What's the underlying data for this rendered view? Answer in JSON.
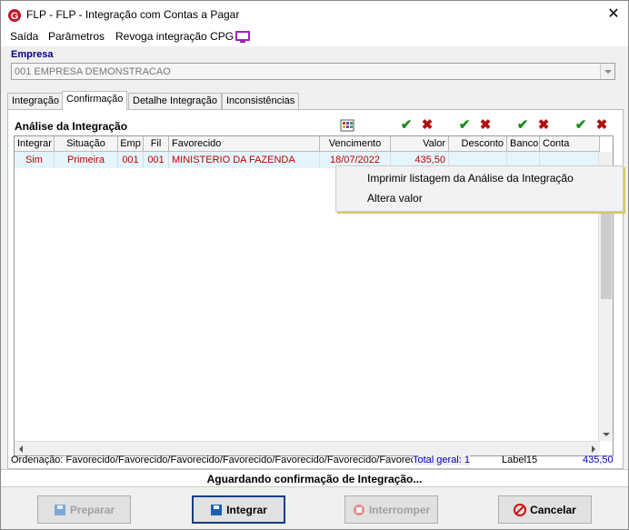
{
  "window": {
    "title": "FLP -  FLP - Integração com Contas a Pagar",
    "close_glyph": "✕"
  },
  "menu": {
    "items": [
      "Saída",
      "Parâmetros",
      "Revoga integração CPG"
    ]
  },
  "empresa": {
    "label": "Empresa",
    "value": "001 EMPRESA DEMONSTRACAO"
  },
  "tabs": [
    "Integração",
    "Confirmação",
    "Detalhe Integração",
    "Inconsistências"
  ],
  "panel": {
    "title": "Análise da Integração"
  },
  "grid": {
    "columns": [
      "Integrar",
      "Situação",
      "Emp",
      "Fil",
      "Favorecido",
      "Vencimento",
      "Valor",
      "Desconto",
      "Banco",
      "Conta"
    ],
    "rows": [
      [
        "Sim",
        "Primeira",
        "001",
        "001",
        "MINISTERIO DA FAZENDA",
        "18/07/2022",
        "435,50",
        "",
        "",
        ""
      ]
    ]
  },
  "context_menu": {
    "items": [
      "Imprimir listagem da Análise da Integração",
      "Altera valor"
    ]
  },
  "status_line": {
    "ordering": "Ordenação: Favorecido/Favorecido/Favorecido/Favorecido/Favorecido/Favorecido/Favorecido/Valor/\\",
    "total_geral": "Total geral: 1",
    "label15": "Label15",
    "total_value": "435,50"
  },
  "bottom_status": "Aguardando confirmação de Integração...",
  "buttons": {
    "preparar": "Preparar",
    "integrar": "Integrar",
    "interromper": "Interromper",
    "cancelar": "Cancelar"
  },
  "colors": {
    "accent": "#000080",
    "row_text": "#c00000",
    "row_bg": "#e4f5fb",
    "check": "#1a8a1a",
    "cross": "#b01010"
  }
}
